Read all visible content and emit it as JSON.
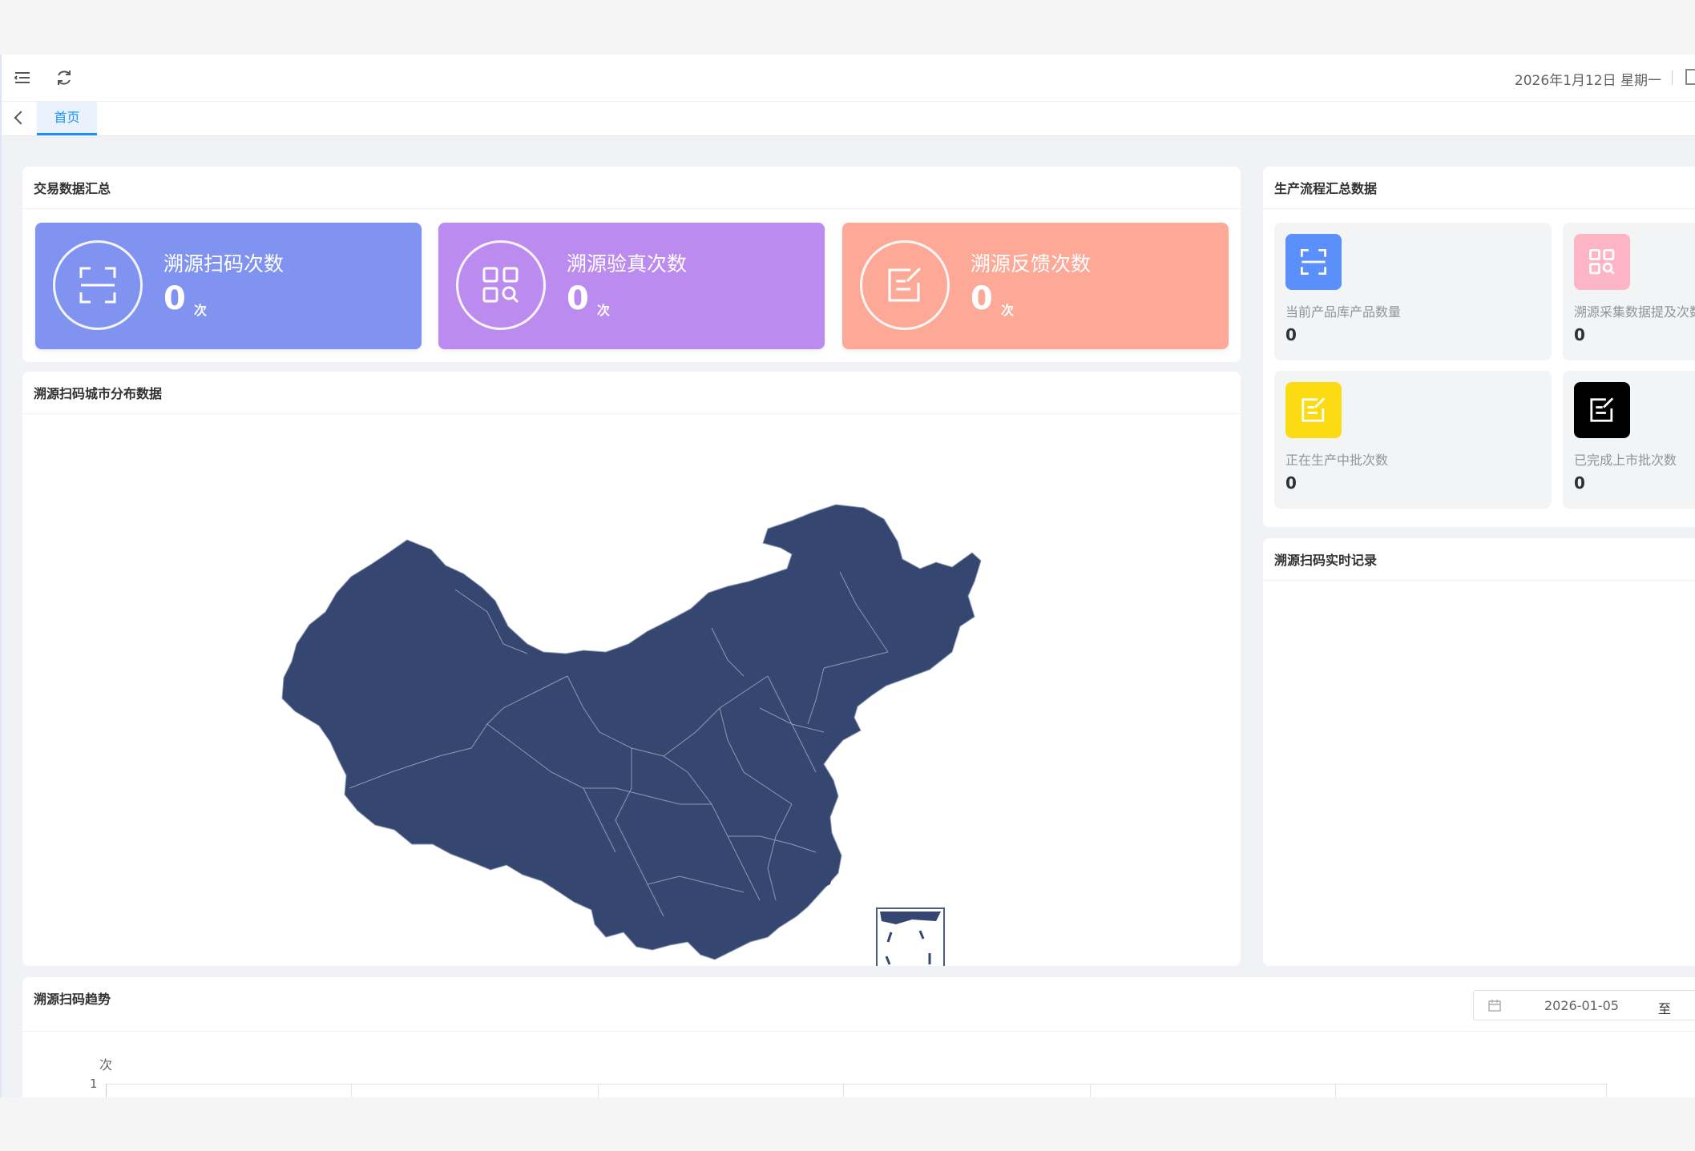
{
  "header": {
    "date_text": "2026年1月12日 星期一",
    "icons": [
      "menu-fold-icon",
      "refresh-icon",
      "fullscreen-icon"
    ]
  },
  "tabs": [
    {
      "label": "首页",
      "active": true
    }
  ],
  "trade_summary": {
    "title": "交易数据汇总",
    "stats": [
      {
        "label": "溯源扫码次数",
        "value": "0",
        "unit": "次",
        "color": "#8093f1",
        "icon": "scan-icon"
      },
      {
        "label": "溯源验真次数",
        "value": "0",
        "unit": "次",
        "color": "#bb8bef",
        "icon": "qrcode-search-icon"
      },
      {
        "label": "溯源反馈次数",
        "value": "0",
        "unit": "次",
        "color": "#fea997",
        "icon": "edit-note-icon"
      }
    ]
  },
  "map_panel": {
    "title": "溯源扫码城市分布数据",
    "map_fill": "#354770"
  },
  "production": {
    "title": "生产流程汇总数据",
    "items": [
      {
        "label": "当前产品库产品数量",
        "value": "0",
        "color": "#5b8ff9",
        "icon": "scan-icon"
      },
      {
        "label": "溯源采集数据提及次数",
        "value": "0",
        "color": "#fdb5c6",
        "icon": "qrcode-search-icon"
      },
      {
        "label": "正在生产中批次数",
        "value": "0",
        "color": "#fadb14",
        "icon": "edit-note-icon"
      },
      {
        "label": "已完成上市批次数",
        "value": "0",
        "color": "#000000",
        "icon": "edit-note-icon"
      }
    ]
  },
  "realtime": {
    "title": "溯源扫码实时记录"
  },
  "trend": {
    "title": "溯源扫码趋势",
    "date_from": "2026-01-05",
    "date_separator": "至",
    "y_unit": "次",
    "y_tick": "1"
  }
}
